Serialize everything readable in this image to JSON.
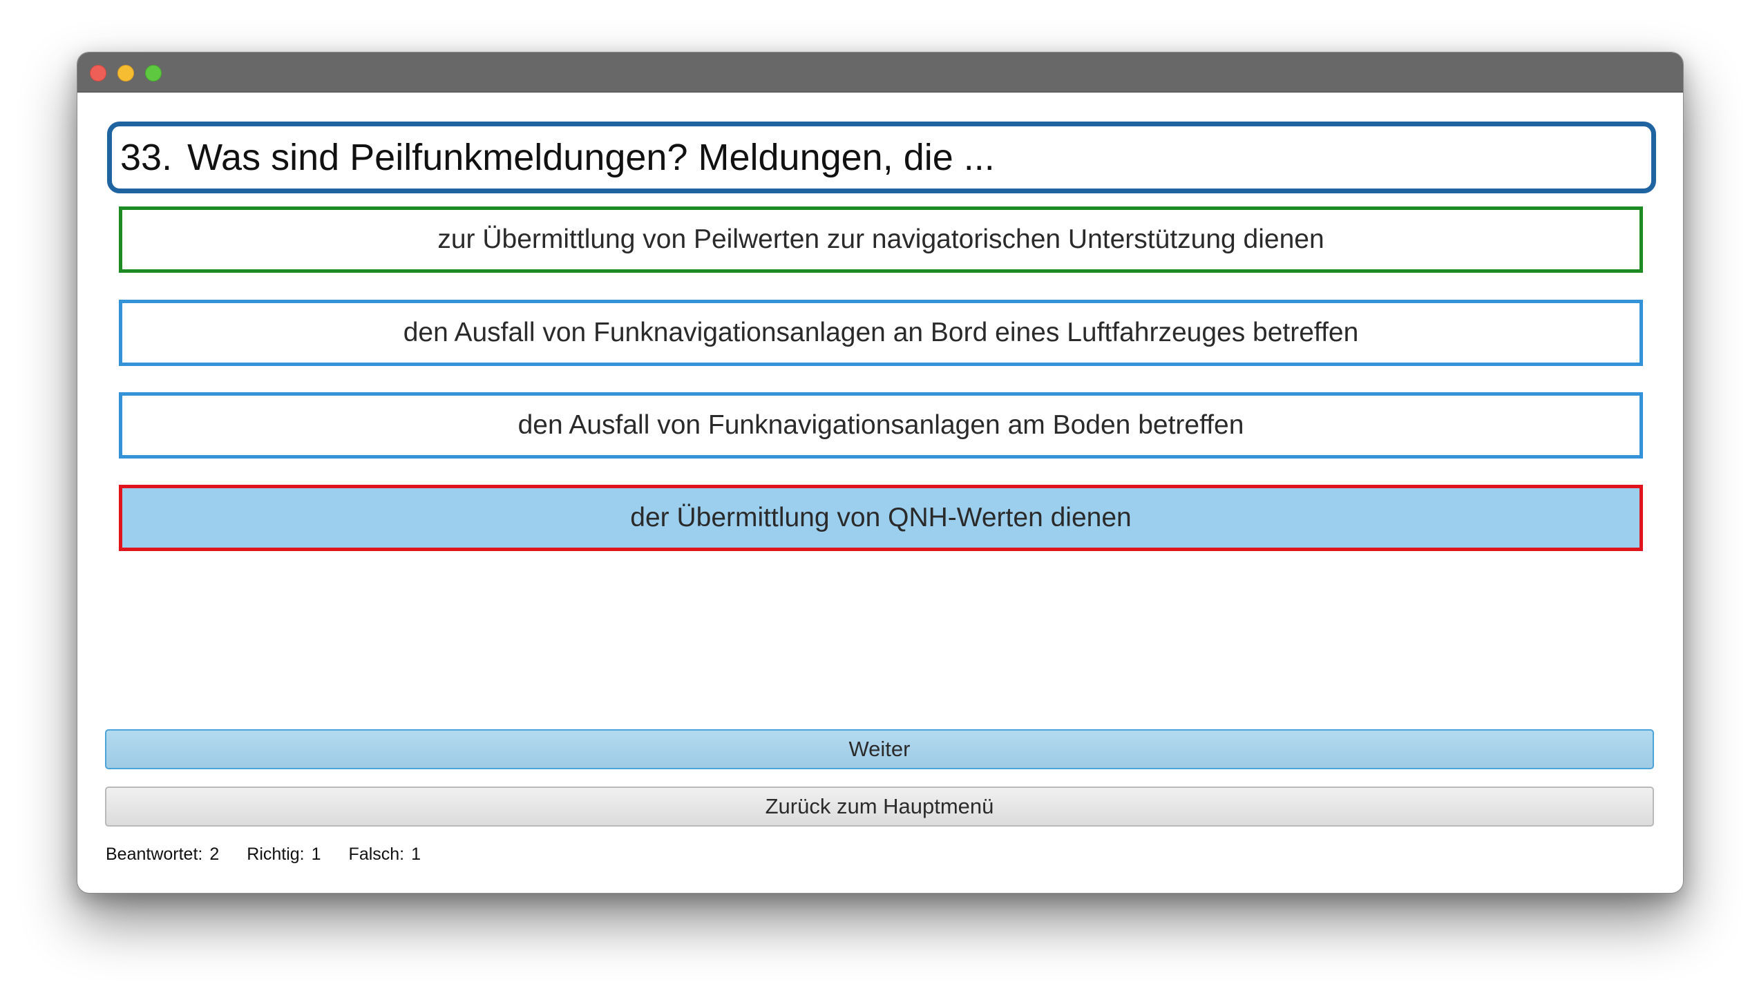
{
  "window": {
    "controls": [
      "close",
      "minimize",
      "maximize"
    ]
  },
  "question": {
    "number": "33.",
    "text": "Was sind Peilfunkmeldungen? Meldungen, die ..."
  },
  "answers": [
    {
      "text": "zur Übermittlung von Peilwerten zur navigatorischen Unterstützung dienen",
      "state": "correct",
      "border_color": "#1d8a22"
    },
    {
      "text": "den Ausfall von Funknavigationsanlagen an Bord eines Luftfahrzeuges betreffen",
      "state": "neutral",
      "border_color": "#3492d8"
    },
    {
      "text": "den Ausfall von Funknavigationsanlagen am Boden betreffen",
      "state": "neutral",
      "border_color": "#3492d8"
    },
    {
      "text": "der Übermittlung von QNH-Werten dienen",
      "state": "selected-wrong",
      "border_color": "#e0141c",
      "fill_color": "#9ccfee"
    }
  ],
  "buttons": {
    "next_label": "Weiter",
    "back_label": "Zurück zum Hauptmenü"
  },
  "status": {
    "answered_label": "Beantwortet:",
    "answered_value": "2",
    "correct_label": "Richtig:",
    "correct_value": "1",
    "wrong_label": "Falsch:",
    "wrong_value": "1"
  },
  "colors": {
    "question_border": "#1f63a0",
    "titlebar": "#686868"
  }
}
